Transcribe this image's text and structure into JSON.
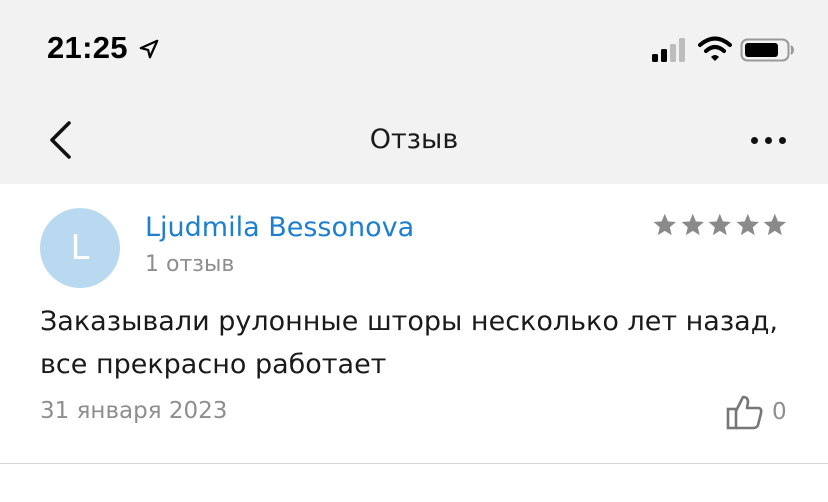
{
  "status_bar": {
    "time": "21:25",
    "icons": [
      "location-arrow-icon",
      "cellular-signal-icon",
      "wifi-icon",
      "battery-icon"
    ]
  },
  "nav": {
    "title": "Отзыв",
    "back_icon": "chevron-left-icon",
    "more_icon": "more-dots-icon"
  },
  "review": {
    "avatar_letter": "L",
    "author": "Ljudmila Bessonova",
    "review_count": "1 отзыв",
    "rating": 5,
    "rating_max": 5,
    "text": "Заказывали рулонные шторы несколько лет назад, все прекрасно работает",
    "date": "31 января 2023",
    "likes": "0",
    "like_icon": "thumbs-up-icon"
  },
  "colors": {
    "header_bg": "#f2f2f2",
    "author_link": "#1e7fd0",
    "avatar_bg": "#b9d9f0",
    "star": "#8a8a8a",
    "muted_text": "#8e8e8e"
  }
}
